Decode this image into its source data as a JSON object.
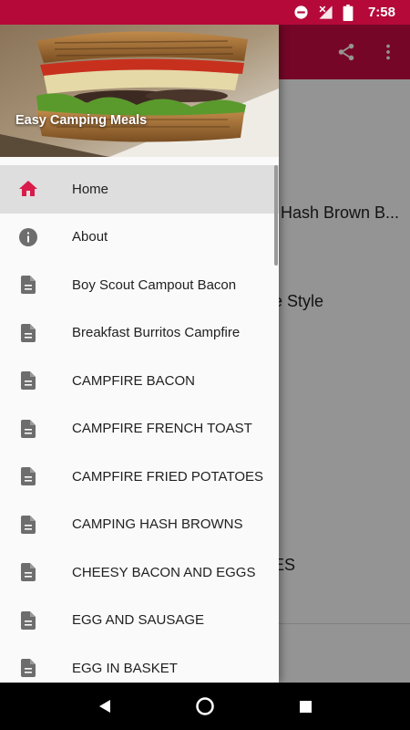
{
  "status_bar": {
    "time": "7:58",
    "icons": [
      "do-not-disturb-icon",
      "signal-off-icon",
      "battery-icon"
    ]
  },
  "app": {
    "icons": [
      "share-icon",
      "more-vert-icon"
    ],
    "content_fragments": [
      "Hash Brown B...",
      "e Style",
      "ES"
    ]
  },
  "drawer": {
    "header_title": "Easy Camping Meals",
    "items": [
      {
        "label": "Home",
        "icon": "home-icon",
        "active": true
      },
      {
        "label": "About",
        "icon": "info-icon",
        "active": false
      },
      {
        "label": "Boy Scout Campout Bacon",
        "icon": "document-icon",
        "active": false
      },
      {
        "label": "Breakfast Burritos Campfire",
        "icon": "document-icon",
        "active": false
      },
      {
        "label": "CAMPFIRE BACON",
        "icon": "document-icon",
        "active": false
      },
      {
        "label": "CAMPFIRE FRENCH TOAST",
        "icon": "document-icon",
        "active": false
      },
      {
        "label": "CAMPFIRE FRIED POTATOES",
        "icon": "document-icon",
        "active": false
      },
      {
        "label": "CAMPING HASH BROWNS",
        "icon": "document-icon",
        "active": false
      },
      {
        "label": "CHEESY BACON AND EGGS",
        "icon": "document-icon",
        "active": false
      },
      {
        "label": "EGG AND SAUSAGE",
        "icon": "document-icon",
        "active": false
      },
      {
        "label": "EGG IN BASKET",
        "icon": "document-icon",
        "active": false
      }
    ]
  },
  "nav_bar": {
    "icons": [
      "back-icon",
      "home-circle-icon",
      "recents-icon"
    ]
  },
  "colors": {
    "status_bar": "#b5093a",
    "app_bar": "#cc0c44",
    "accent_icon": "#d81b4a",
    "drawer_icon": "#6d6d6d",
    "drawer_bg": "#fafafa",
    "active_item_bg": "#dedede"
  }
}
